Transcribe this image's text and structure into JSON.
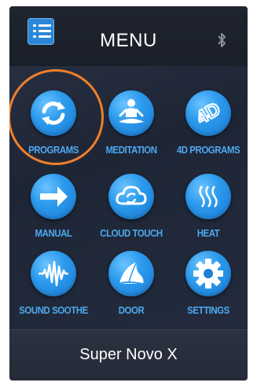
{
  "header": {
    "title": "MENU",
    "menu_icon": "list-icon",
    "status_icon": "bluetooth-icon"
  },
  "menu_items": [
    {
      "label": "PROGRAMS",
      "icon": "refresh-arrows-icon",
      "highlighted": true
    },
    {
      "label": "MEDITATION",
      "icon": "meditation-person-icon",
      "highlighted": false
    },
    {
      "label": "4D PROGRAMS",
      "icon": "4d-icon",
      "highlighted": false
    },
    {
      "label": "MANUAL",
      "icon": "arrow-right-icon",
      "highlighted": false
    },
    {
      "label": "CLOUD TOUCH",
      "icon": "cloud-icon",
      "highlighted": false
    },
    {
      "label": "HEAT",
      "icon": "heat-waves-icon",
      "highlighted": false
    },
    {
      "label": "SOUND SOOTHE",
      "icon": "sound-wave-icon",
      "highlighted": false
    },
    {
      "label": "DOOR",
      "icon": "door-shell-icon",
      "highlighted": false
    },
    {
      "label": "SETTINGS",
      "icon": "gear-icon",
      "highlighted": false
    }
  ],
  "footer": {
    "device_name": "Super Novo X"
  },
  "colors": {
    "accent": "#2c9bee",
    "label": "#4ea8ef",
    "highlight_ring": "#f07f2a",
    "background": "#1e2636"
  }
}
